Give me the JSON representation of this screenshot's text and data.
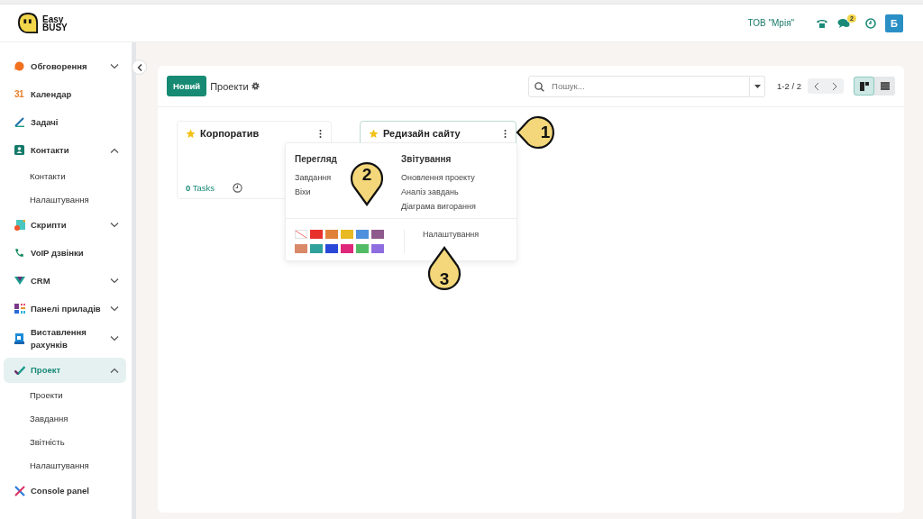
{
  "header": {
    "logo_top": "Easy",
    "logo_bottom": "BUSY",
    "company": "ТОВ \"Мрія\"",
    "chat_badge": "2",
    "avatar": "Б"
  },
  "sidebar": {
    "items": [
      {
        "label": "Обговорення",
        "selected": false,
        "expanded": false
      },
      {
        "label": "Календар",
        "selected": false
      },
      {
        "label": "Задачі",
        "selected": false
      },
      {
        "label": "Контакти",
        "selected": false,
        "expanded": true,
        "children": [
          {
            "label": "Контакти"
          },
          {
            "label": "Налаштування"
          }
        ]
      },
      {
        "label": "Скрипти",
        "selected": false,
        "expanded": false
      },
      {
        "label": "VoIP дзвінки",
        "selected": false
      },
      {
        "label": "CRM",
        "selected": false,
        "expanded": false
      },
      {
        "label": "Панелі приладів",
        "selected": false,
        "expanded": false
      },
      {
        "label": "Виставлення рахунків",
        "selected": false,
        "expanded": false
      },
      {
        "label": "Проект",
        "selected": true,
        "expanded": true,
        "children": [
          {
            "label": "Проекти"
          },
          {
            "label": "Завдання"
          },
          {
            "label": "Звітність"
          },
          {
            "label": "Налаштування"
          }
        ]
      },
      {
        "label": "Console panel",
        "selected": false
      }
    ]
  },
  "calendar_icon_text": "31",
  "toolbar": {
    "new_button": "Новий",
    "breadcrumb": "Проекти",
    "search": {
      "placeholder": "Пошук..."
    },
    "pager": "1-2 / 2",
    "views": [
      {
        "kind": "kanban",
        "selected": true
      },
      {
        "kind": "list",
        "selected": false
      }
    ]
  },
  "cards": [
    {
      "title": "Корпоратив",
      "favorite": true,
      "footer": {
        "count": "0",
        "label": "Tasks"
      }
    },
    {
      "title": "Редизайн сайту",
      "favorite": true
    }
  ],
  "card_menu": {
    "sections": [
      {
        "title": "Перегляд",
        "items": [
          "Завдання",
          "Віхи"
        ]
      },
      {
        "title": "Звітування",
        "items": [
          "Оновлення проекту",
          "Аналіз завдань",
          "Діаграма вигорання"
        ]
      }
    ],
    "swatches": [
      {
        "kind": "none"
      },
      {
        "kind": "color",
        "color": "#e8302c"
      },
      {
        "kind": "color",
        "color": "#e0813a"
      },
      {
        "kind": "color",
        "color": "#e8b923"
      },
      {
        "kind": "color",
        "color": "#4e8fde"
      },
      {
        "kind": "color",
        "color": "#8f5a8d"
      },
      {
        "kind": "color",
        "color": "#d98868"
      },
      {
        "kind": "color",
        "color": "#2fa19a"
      },
      {
        "kind": "color",
        "color": "#2a48d8"
      },
      {
        "kind": "color",
        "color": "#e0287b"
      },
      {
        "kind": "color",
        "color": "#52bb65"
      },
      {
        "kind": "color",
        "color": "#8e6de0"
      }
    ],
    "settings": "Налаштування"
  },
  "callouts": [
    {
      "number": "1",
      "kind": "left"
    },
    {
      "number": "2",
      "kind": "down"
    },
    {
      "number": "3",
      "kind": "up"
    }
  ]
}
